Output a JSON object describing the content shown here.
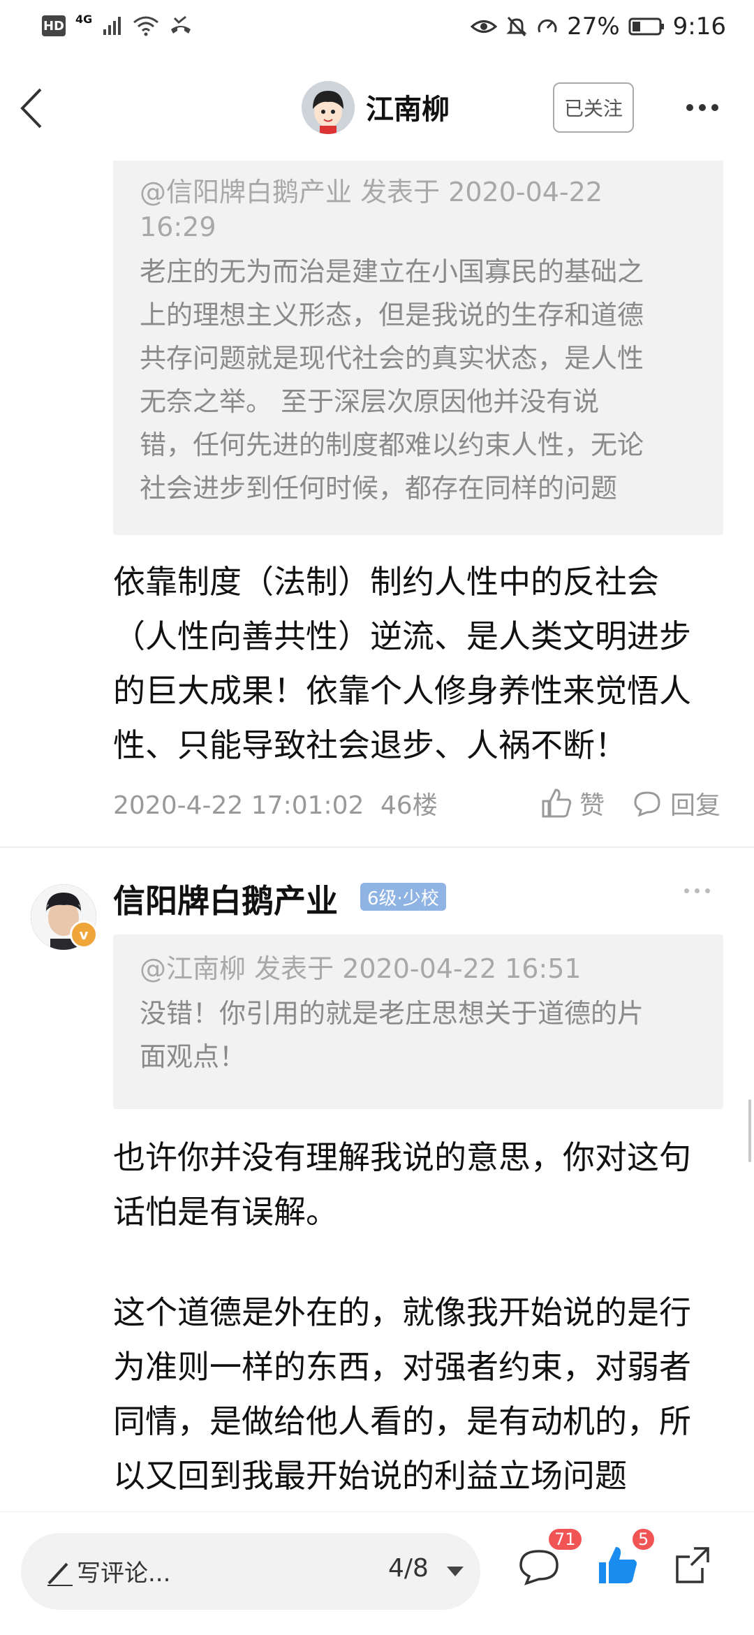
{
  "status_bar": {
    "hd": "HD",
    "network": "4G",
    "battery_percent": "27%",
    "time": "9:16"
  },
  "header": {
    "title": "江南柳",
    "follow_label": "已关注"
  },
  "post": {
    "quote": {
      "meta_line1": "@信阳牌白鹅产业 发表于 2020-04-22",
      "meta_line2": "16:29",
      "lines": [
        "老庄的无为而治是建立在小国寡民的基础之",
        "上的理想主义形态，但是我说的生存和道德",
        "共存问题就是现代社会的真实状态，是人性",
        "无奈之举。 至于深层次原因他并没有说",
        "错，任何先进的制度都难以约束人性，无论",
        "社会进步到任何时候，都存在同样的问题"
      ]
    },
    "reply_lines": [
      "依靠制度（法制）制约人性中的反社会",
      "（人性向善共性）逆流、是人类文明进步",
      "的巨大成果！依靠个人修身养性来觉悟人",
      "性、只能导致社会退步、人祸不断！"
    ],
    "time": "2020-4-22 17:01:02",
    "floor": "46楼",
    "like_label": "赞",
    "reply_label": "回复"
  },
  "comment": {
    "author": "信阳牌白鹅产业",
    "level": "6级·少校",
    "quote": {
      "meta": "@江南柳 发表于 2020-04-22 16:51",
      "lines": [
        "没错！你引用的就是老庄思想关于道德的片",
        "面观点！"
      ]
    },
    "paragraph1": [
      "也许你并没有理解我说的意思，你对这句",
      "话怕是有误解。"
    ],
    "paragraph2": [
      "这个道德是外在的，就像我开始说的是行",
      "为准则一样的东西，对强者约束，对弱者",
      "同情，是做给他人看的，是有动机的，所",
      "以又回到我最开始说的利益立场问题"
    ]
  },
  "bottom_bar": {
    "comment_placeholder": "写评论...",
    "page_indicator": "4/8",
    "comment_count": "71",
    "like_count": "5"
  },
  "colors": {
    "like_blue": "#1a8cf0",
    "badge_red": "#f05454",
    "level_badge": "#8fb3e3",
    "quote_bg": "#f2f2f2"
  },
  "icons": [
    "back-icon",
    "avatar-cartoon",
    "more-icon",
    "thumb-up-icon",
    "comment-bubble-icon",
    "pen-icon",
    "share-icon",
    "verified-badge"
  ]
}
